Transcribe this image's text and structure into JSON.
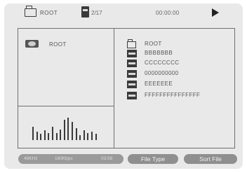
{
  "top_bar": {
    "folder_icon": "folder-icon",
    "root_label": "ROOT",
    "file_icon": "film-icon",
    "file_count": "2/17",
    "time": "00:00:00",
    "play_icon": "play-icon"
  },
  "left_panel": {
    "disc_icon": "disc-icon",
    "root_label": "ROOT"
  },
  "spectrum": {
    "levels": [
      0.55,
      0.35,
      0.25,
      0.4,
      0.3,
      0.55,
      0.3,
      0.45,
      0.85,
      0.95,
      0.75,
      0.5,
      0.2,
      0.4,
      0.3,
      0.35,
      0.25
    ]
  },
  "file_list": {
    "items": [
      {
        "type": "folder",
        "icon": "folder-icon",
        "label": "ROOT"
      },
      {
        "type": "file",
        "icon": "film-icon",
        "label": "BBBBBBB"
      },
      {
        "type": "file",
        "icon": "film-icon",
        "label": "CCCCCCCC"
      },
      {
        "type": "file",
        "icon": "film-icon",
        "label": "0000000000"
      },
      {
        "type": "file",
        "icon": "film-icon",
        "label": "EEEEEEE"
      },
      {
        "type": "file",
        "icon": "film-icon",
        "label": "FFFFFFFFFFFFFFF"
      }
    ]
  },
  "status_bar": {
    "sample_rate": "48KHz",
    "bitrate": "160Kbps",
    "duration": "03:58",
    "file_type_button": "File Type",
    "sort_file_button": "Sort File"
  },
  "colors": {
    "frame": "#e9e9e9",
    "border": "#707070",
    "pill": "#8f8f8f"
  }
}
